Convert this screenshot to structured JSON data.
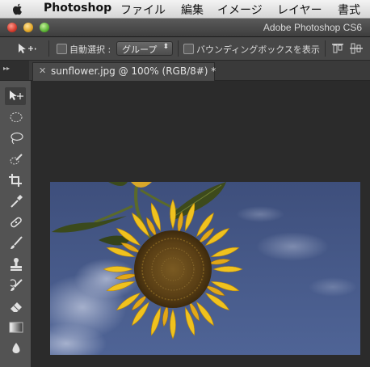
{
  "menubar": {
    "app_name": "Photoshop",
    "items": [
      "ファイル",
      "編集",
      "イメージ",
      "レイヤー",
      "書式"
    ]
  },
  "window": {
    "title": "Adobe Photoshop CS6"
  },
  "options": {
    "auto_select_label": "自動選択 :",
    "auto_select_value": "グループ",
    "bounding_box_label": "バウンディングボックスを表示"
  },
  "document": {
    "tab_label": "sunflower.jpg @ 100% (RGB/8#) *"
  },
  "tools": [
    "move-tool",
    "marquee-tool",
    "lasso-tool",
    "quick-selection-tool",
    "crop-tool",
    "eyedropper-tool",
    "healing-brush-tool",
    "brush-tool",
    "clone-stamp-tool",
    "history-brush-tool",
    "eraser-tool",
    "gradient-tool",
    "blur-tool"
  ],
  "colors": {
    "accent_sky": "#4a5d8c",
    "sunflower": "#f0c21e"
  }
}
